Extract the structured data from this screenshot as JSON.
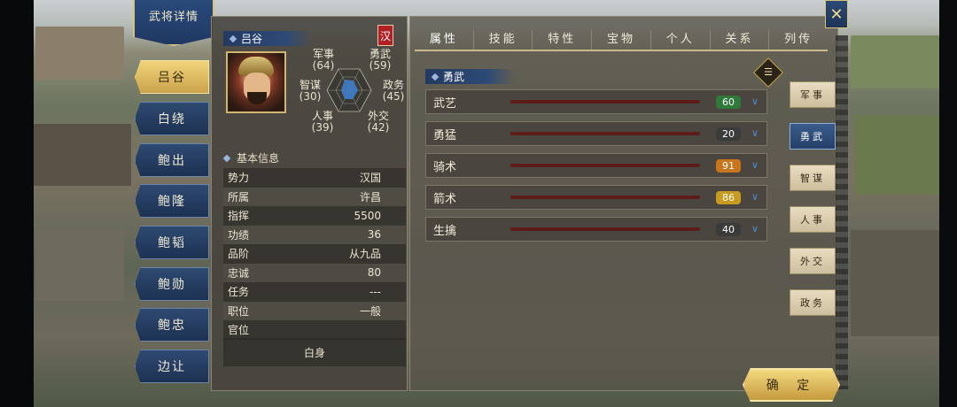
{
  "window": {
    "title": "武将详情"
  },
  "left_tabs": [
    {
      "label": "吕谷",
      "active": true
    },
    {
      "label": "白绕",
      "active": false
    },
    {
      "label": "鲍出",
      "active": false
    },
    {
      "label": "鲍隆",
      "active": false
    },
    {
      "label": "鲍韬",
      "active": false
    },
    {
      "label": "鲍勋",
      "active": false
    },
    {
      "label": "鲍忠",
      "active": false
    },
    {
      "label": "边让",
      "active": false
    }
  ],
  "general": {
    "name": "吕谷",
    "faction_flag": "汉",
    "stats": {
      "military": {
        "label": "军事",
        "value": "(64)"
      },
      "bravery": {
        "label": "勇武",
        "value": "(59)"
      },
      "intellect": {
        "label": "智谋",
        "value": "(30)"
      },
      "politics": {
        "label": "政务",
        "value": "(45)"
      },
      "personnel": {
        "label": "人事",
        "value": "(39)"
      },
      "diplomacy": {
        "label": "外交",
        "value": "(42)"
      }
    }
  },
  "basic_info": {
    "title": "基本信息",
    "rows": [
      {
        "label": "势力",
        "value": "汉国"
      },
      {
        "label": "所属",
        "value": "许昌"
      },
      {
        "label": "指挥",
        "value": "5500"
      },
      {
        "label": "功绩",
        "value": "36"
      },
      {
        "label": "品阶",
        "value": "从九品"
      },
      {
        "label": "忠诚",
        "value": "80"
      },
      {
        "label": "任务",
        "value": "---"
      },
      {
        "label": "职位",
        "value": "一般"
      },
      {
        "label": "官位",
        "value": ""
      }
    ],
    "status": "白身"
  },
  "tabs": [
    "属性",
    "技能",
    "特性",
    "宝物",
    "个人",
    "关系",
    "列传"
  ],
  "section": {
    "title": "勇武"
  },
  "attributes": [
    {
      "label": "武艺",
      "value": "60",
      "badge_color": "#2f7a3a"
    },
    {
      "label": "勇猛",
      "value": "20",
      "badge_color": "#3b3b3b"
    },
    {
      "label": "骑术",
      "value": "91",
      "badge_color": "#c7761e"
    },
    {
      "label": "箭术",
      "value": "86",
      "badge_color": "#c79a22"
    },
    {
      "label": "生擒",
      "value": "40",
      "badge_color": "#3b3b3b"
    }
  ],
  "right_tabs": [
    {
      "label": "军事",
      "active": false
    },
    {
      "label": "勇武",
      "active": true
    },
    {
      "label": "智谋",
      "active": false
    },
    {
      "label": "人事",
      "active": false
    },
    {
      "label": "外交",
      "active": false
    },
    {
      "label": "政务",
      "active": false
    }
  ],
  "confirm_label": "确 定",
  "icons": {
    "close": "close-icon",
    "list": "list-icon",
    "expand": "chevron-down-icon"
  }
}
